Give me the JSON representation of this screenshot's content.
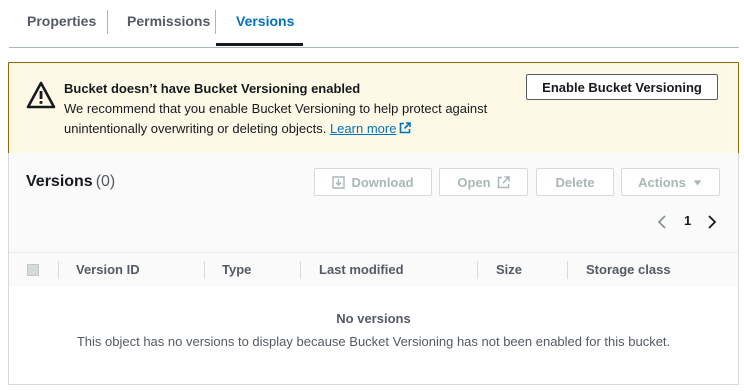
{
  "tabs": [
    {
      "label": "Properties"
    },
    {
      "label": "Permissions"
    },
    {
      "label": "Versions",
      "active": true
    }
  ],
  "banner": {
    "title": "Bucket doesn’t have Bucket Versioning enabled",
    "text": "We recommend that you enable Bucket Versioning to help protect against unintentionally overwriting or deleting objects.",
    "link": "Learn more",
    "button": "Enable Bucket Versioning",
    "icon": "warning-icon"
  },
  "versions": {
    "title": "Versions",
    "count": "(0)",
    "buttons": {
      "download": "Download",
      "open": "Open",
      "delete": "Delete",
      "actions": "Actions"
    },
    "pagination": {
      "current": "1"
    },
    "columns": [
      "Version ID",
      "Type",
      "Last modified",
      "Size",
      "Storage class"
    ],
    "empty_title": "No versions",
    "empty_text": "This object has no versions to display because Bucket Versioning has not been enabled for this bucket."
  },
  "colors": {
    "accent": "#0073bb",
    "warning_bg": "#fef9e6",
    "warning_border": "#8d6605"
  }
}
